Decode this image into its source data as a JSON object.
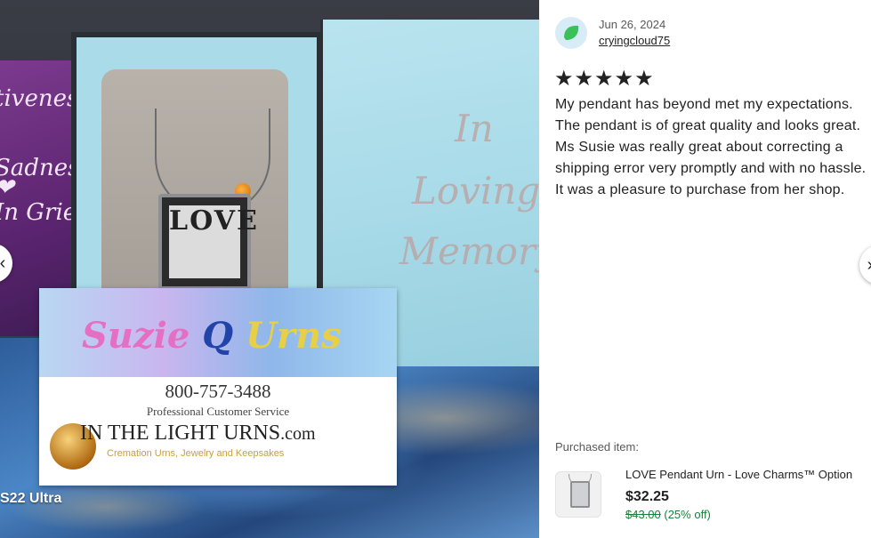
{
  "photo": {
    "purple_card_lines": [
      "tiveness",
      "Sadness",
      "In Grief"
    ],
    "box_lid_lines": [
      "In",
      "Loving",
      "Memory"
    ],
    "pendant_text": "LOVE",
    "business_card": {
      "brand_part1": "Suzie",
      "brand_part2": "Q",
      "brand_part3": "Urns",
      "phone": "800-757-3488",
      "service": "Professional Customer Service",
      "company": "IN THE LIGHT URNS",
      "company_suffix": ".com",
      "tagline": "Cremation Urns, Jewelry and Keepsakes"
    },
    "device_label": "S22 Ultra"
  },
  "navigation": {
    "prev_icon": "chevron-left-icon",
    "next_icon": "chevron-right-icon"
  },
  "review": {
    "avatar_icon": "leaf-avatar-icon",
    "avatar_color": "#3cc15a",
    "date": "Jun 26, 2024",
    "username": "cryingcloud75",
    "rating": 5,
    "stars": [
      "★",
      "★",
      "★",
      "★",
      "★"
    ],
    "body": "My pendant has beyond met my expectations. The pendant is of great quality and looks great. Ms Susie was really great about correcting a shipping error very promptly and with no hassle. It was a pleasure to purchase from her shop."
  },
  "purchased": {
    "label": "Purchased item:",
    "title": "LOVE Pendant Urn - Love Charms™ Option",
    "price": "$32.25",
    "original_price": "$43.00",
    "discount": " (25% off)",
    "discount_color": "#1a7f3c"
  }
}
